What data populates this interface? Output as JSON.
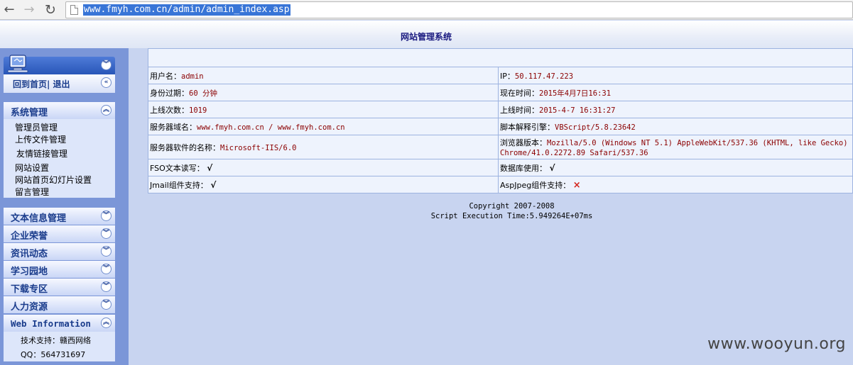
{
  "browser": {
    "url": "www.fmyh.com.cn/admin/admin_index.asp",
    "back_glyph": "←",
    "forward_glyph": "→",
    "reload_glyph": "↻"
  },
  "header": {
    "title": "网站管理系统"
  },
  "sidebar": {
    "home_links": "回到首页| 退出",
    "expand_glyph": "︾",
    "collapse_glyph": "︽",
    "back_glyph": "«",
    "system_panel": {
      "title": "系统管理",
      "items": [
        "管理员管理",
        "上传文件管理",
        "友情链接管理",
        "网站设置",
        "网站首页幻灯片设置",
        "留言管理"
      ]
    },
    "sections": [
      "文本信息管理",
      "企业荣誉",
      "资讯动态",
      "学习园地",
      "下载专区",
      "人力资源"
    ],
    "web_panel": {
      "title": "Web Information",
      "support": "技术支持：赣西网络",
      "qq": "QQ：564731697"
    }
  },
  "info": {
    "username_label": "用户名：",
    "username_value": "admin",
    "ip_label": "IP：",
    "ip_value": "50.117.47.223",
    "expire_label": "身份过期：",
    "expire_value": "60 分钟",
    "now_label": "现在时间：",
    "now_value": "2015年4月7日16:31",
    "logins_label": "上线次数：",
    "logins_value": "1019",
    "last_label": "上线时间：",
    "last_value": "2015-4-7 16:31:27",
    "domain_label": "服务器域名：",
    "domain_value": "www.fmyh.com.cn / www.fmyh.com.cn",
    "script_label": "脚本解释引擎：",
    "script_value": "VBScript/5.8.23642",
    "software_label": "服务器软件的名称：",
    "software_value": "Microsoft-IIS/6.0",
    "browser_label": "浏览器版本：",
    "browser_value_1": "Mozilla/5.0 (Windows NT 5.1) AppleWebKit/537.36 (KHTML, like Gecko)",
    "browser_value_2": "Chrome/41.0.2272.89 Safari/537.36",
    "fso_label": "FSO文本读写：",
    "fso_value": "√",
    "db_label": "数据库使用：",
    "db_value": "√",
    "jmail_label": "Jmail组件支持：",
    "jmail_value": "√",
    "aspjpeg_label": "AspJpeg组件支持：",
    "aspjpeg_value": "×"
  },
  "footer": {
    "copyright": "Copyright 2007-2008",
    "exec_time": "Script Execution Time:5.949264E+07ms"
  },
  "watermark": "www.wooyun.org"
}
